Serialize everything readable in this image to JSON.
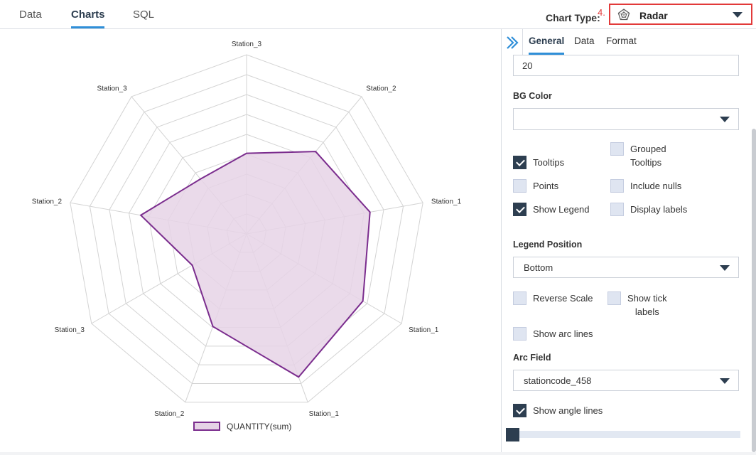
{
  "top_tabs": [
    {
      "label": "Data"
    },
    {
      "label": "Charts"
    },
    {
      "label": "SQL"
    }
  ],
  "chart_type": {
    "label": "Chart Type:",
    "step": "4.",
    "value": "Radar",
    "icon": "radar-chart-icon"
  },
  "panel": {
    "tabs": [
      {
        "label": "General"
      },
      {
        "label": "Data"
      },
      {
        "label": "Format"
      }
    ],
    "size_value": "20",
    "bg_color_label": "BG Color",
    "bg_color_value": "",
    "checkboxes": {
      "tooltips": {
        "label": "Tooltips",
        "checked": true
      },
      "grouped_tooltips": {
        "label": "Grouped\nTooltips",
        "checked": false
      },
      "points": {
        "label": "Points",
        "checked": false
      },
      "include_nulls": {
        "label": "Include nulls",
        "checked": false
      },
      "show_legend": {
        "label": "Show Legend",
        "checked": true
      },
      "display_labels": {
        "label": "Display labels",
        "checked": false
      },
      "reverse_scale": {
        "label": "Reverse Scale",
        "checked": false
      },
      "show_tick_labels": {
        "label": "Show tick\nlabels",
        "checked": false
      },
      "show_arc_lines": {
        "label": "Show arc lines",
        "checked": false
      },
      "show_angle_lines": {
        "label": "Show angle lines",
        "checked": true
      }
    },
    "legend_position_label": "Legend Position",
    "legend_position_value": "Bottom",
    "arc_field_label": "Arc Field",
    "arc_field_value": "stationcode_458",
    "slider_value": 0
  },
  "chart_data": {
    "type": "radar",
    "categories": [
      "Station_3",
      "Station_2",
      "Station_1",
      "Station_1",
      "Station_1",
      "Station_2",
      "Station_3",
      "Station_2",
      "Station_3"
    ],
    "series": [
      {
        "name": "QUANTITY(sum)",
        "values": [
          45,
          60,
          70,
          75,
          85,
          55,
          35,
          60,
          40
        ]
      }
    ],
    "rmax": 100,
    "rings": 9,
    "legend": "bottom",
    "colors": {
      "line": "#7b2d8e",
      "fill": "#e6d3e6",
      "grid": "#d3d3d3"
    }
  }
}
